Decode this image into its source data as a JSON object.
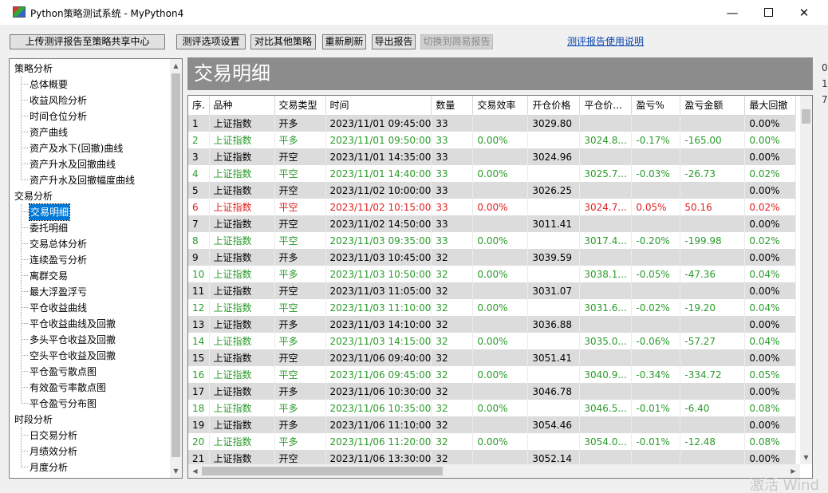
{
  "window": {
    "title": "Python策略测试系统 - MyPython4"
  },
  "toolbar": {
    "upload": "上传测评报告至策略共享中心",
    "options": "测评选项设置",
    "compare": "对比其他策略",
    "refresh": "重新刷新",
    "export": "导出报告",
    "simple": "切换到简易报告",
    "help": "测评报告使用说明"
  },
  "tree": [
    {
      "label": "策略分析",
      "level": 0
    },
    {
      "label": "总体概要",
      "level": 1
    },
    {
      "label": "收益风险分析",
      "level": 1
    },
    {
      "label": "时间仓位分析",
      "level": 1
    },
    {
      "label": "资产曲线",
      "level": 1
    },
    {
      "label": "资产及水下(回撤)曲线",
      "level": 1
    },
    {
      "label": "资产升水及回撤曲线",
      "level": 1
    },
    {
      "label": "资产升水及回撤幅度曲线",
      "level": 1
    },
    {
      "label": "交易分析",
      "level": 0
    },
    {
      "label": "交易明细",
      "level": 1,
      "selected": true
    },
    {
      "label": "委托明细",
      "level": 1
    },
    {
      "label": "交易总体分析",
      "level": 1
    },
    {
      "label": "连续盈亏分析",
      "level": 1
    },
    {
      "label": "离群交易",
      "level": 1
    },
    {
      "label": "最大浮盈浮亏",
      "level": 1
    },
    {
      "label": "平仓收益曲线",
      "level": 1
    },
    {
      "label": "平仓收益曲线及回撤",
      "level": 1
    },
    {
      "label": "多头平仓收益及回撤",
      "level": 1
    },
    {
      "label": "空头平仓收益及回撤",
      "level": 1
    },
    {
      "label": "平仓盈亏散点图",
      "level": 1
    },
    {
      "label": "有效盈亏率散点图",
      "level": 1
    },
    {
      "label": "平仓盈亏分布图",
      "level": 1
    },
    {
      "label": "时段分析",
      "level": 0
    },
    {
      "label": "日交易分析",
      "level": 1
    },
    {
      "label": "月绩效分析",
      "level": 1
    },
    {
      "label": "月度分析",
      "level": 1
    }
  ],
  "panel": {
    "title": "交易明细",
    "edge_chars": [
      "0",
      "1",
      "7"
    ]
  },
  "table": {
    "columns": [
      "序.",
      "品种",
      "交易类型",
      "时间",
      "数量",
      "交易效率",
      "开仓价格",
      "平仓价...",
      "盈亏%",
      "盈亏金额",
      "最大回撤"
    ],
    "rows": [
      {
        "tone": "black",
        "cells": [
          "1",
          "上证指数",
          "开多",
          "2023/11/01 09:45:00",
          "33",
          "",
          "3029.80",
          "",
          "",
          "",
          "0.00%"
        ]
      },
      {
        "tone": "green",
        "cells": [
          "2",
          "上证指数",
          "平多",
          "2023/11/01 09:50:00",
          "33",
          "0.00%",
          "",
          "3024.8...",
          "-0.17%",
          "-165.00",
          "0.00%"
        ]
      },
      {
        "tone": "black",
        "cells": [
          "3",
          "上证指数",
          "开空",
          "2023/11/01 14:35:00",
          "33",
          "",
          "3024.96",
          "",
          "",
          "",
          "0.00%"
        ]
      },
      {
        "tone": "green",
        "cells": [
          "4",
          "上证指数",
          "平空",
          "2023/11/01 14:40:00",
          "33",
          "0.00%",
          "",
          "3025.7...",
          "-0.03%",
          "-26.73",
          "0.02%"
        ]
      },
      {
        "tone": "black",
        "cells": [
          "5",
          "上证指数",
          "开空",
          "2023/11/02 10:00:00",
          "33",
          "",
          "3026.25",
          "",
          "",
          "",
          "0.00%"
        ]
      },
      {
        "tone": "red",
        "cells": [
          "6",
          "上证指数",
          "平空",
          "2023/11/02 10:15:00",
          "33",
          "0.00%",
          "",
          "3024.7...",
          "0.05%",
          "50.16",
          "0.02%"
        ]
      },
      {
        "tone": "black",
        "cells": [
          "7",
          "上证指数",
          "开空",
          "2023/11/02 14:50:00",
          "33",
          "",
          "3011.41",
          "",
          "",
          "",
          "0.00%"
        ]
      },
      {
        "tone": "green",
        "cells": [
          "8",
          "上证指数",
          "平空",
          "2023/11/03 09:35:00",
          "33",
          "0.00%",
          "",
          "3017.4...",
          "-0.20%",
          "-199.98",
          "0.02%"
        ]
      },
      {
        "tone": "black",
        "cells": [
          "9",
          "上证指数",
          "开多",
          "2023/11/03 10:45:00",
          "32",
          "",
          "3039.59",
          "",
          "",
          "",
          "0.00%"
        ]
      },
      {
        "tone": "green",
        "cells": [
          "10",
          "上证指数",
          "平多",
          "2023/11/03 10:50:00",
          "32",
          "0.00%",
          "",
          "3038.1...",
          "-0.05%",
          "-47.36",
          "0.04%"
        ]
      },
      {
        "tone": "black",
        "cells": [
          "11",
          "上证指数",
          "开空",
          "2023/11/03 11:05:00",
          "32",
          "",
          "3031.07",
          "",
          "",
          "",
          "0.00%"
        ]
      },
      {
        "tone": "green",
        "cells": [
          "12",
          "上证指数",
          "平空",
          "2023/11/03 11:10:00",
          "32",
          "0.00%",
          "",
          "3031.6...",
          "-0.02%",
          "-19.20",
          "0.04%"
        ]
      },
      {
        "tone": "black",
        "cells": [
          "13",
          "上证指数",
          "开多",
          "2023/11/03 14:10:00",
          "32",
          "",
          "3036.88",
          "",
          "",
          "",
          "0.00%"
        ]
      },
      {
        "tone": "green",
        "cells": [
          "14",
          "上证指数",
          "平多",
          "2023/11/03 14:15:00",
          "32",
          "0.00%",
          "",
          "3035.0...",
          "-0.06%",
          "-57.27",
          "0.04%"
        ]
      },
      {
        "tone": "black",
        "cells": [
          "15",
          "上证指数",
          "开空",
          "2023/11/06 09:40:00",
          "32",
          "",
          "3051.41",
          "",
          "",
          "",
          "0.00%"
        ]
      },
      {
        "tone": "green",
        "cells": [
          "16",
          "上证指数",
          "平空",
          "2023/11/06 09:45:00",
          "32",
          "0.00%",
          "",
          "3040.9...",
          "-0.34%",
          "-334.72",
          "0.05%"
        ]
      },
      {
        "tone": "black",
        "cells": [
          "17",
          "上证指数",
          "开多",
          "2023/11/06 10:30:00",
          "32",
          "",
          "3046.78",
          "",
          "",
          "",
          "0.00%"
        ]
      },
      {
        "tone": "green",
        "cells": [
          "18",
          "上证指数",
          "平多",
          "2023/11/06 10:35:00",
          "32",
          "0.00%",
          "",
          "3046.5...",
          "-0.01%",
          "-6.40",
          "0.08%"
        ]
      },
      {
        "tone": "black",
        "cells": [
          "19",
          "上证指数",
          "开多",
          "2023/11/06 11:10:00",
          "32",
          "",
          "3054.46",
          "",
          "",
          "",
          "0.00%"
        ]
      },
      {
        "tone": "green",
        "cells": [
          "20",
          "上证指数",
          "平多",
          "2023/11/06 11:20:00",
          "32",
          "0.00%",
          "",
          "3054.0...",
          "-0.01%",
          "-12.48",
          "0.08%"
        ]
      },
      {
        "tone": "black",
        "cells": [
          "21",
          "上证指数",
          "开空",
          "2023/11/06 13:30:00",
          "32",
          "",
          "3052.14",
          "",
          "",
          "",
          "0.00%"
        ]
      }
    ]
  },
  "watermark": "激活 Wind"
}
